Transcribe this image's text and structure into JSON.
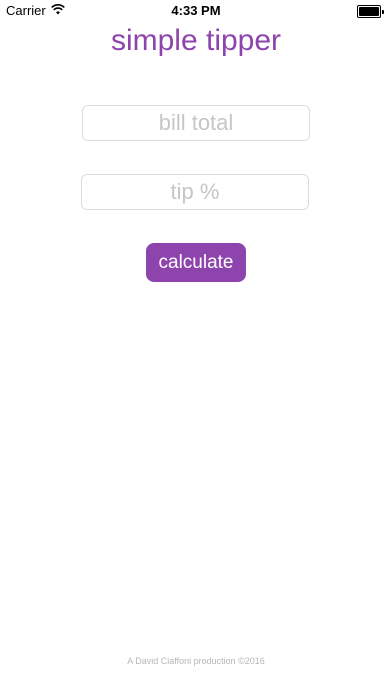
{
  "status_bar": {
    "carrier": "Carrier",
    "time": "4:33 PM",
    "battery_level": 1.0,
    "wifi_icon": "wifi-icon",
    "battery_icon": "battery-icon"
  },
  "app": {
    "title": "simple tipper",
    "accent_color": "#8e44ad"
  },
  "form": {
    "bill_placeholder": "bill total",
    "bill_value": "",
    "tip_placeholder": "tip %",
    "tip_value": "",
    "calculate_label": "calculate"
  },
  "footer": {
    "credit": "A David Ciaffoni production ©2016"
  }
}
